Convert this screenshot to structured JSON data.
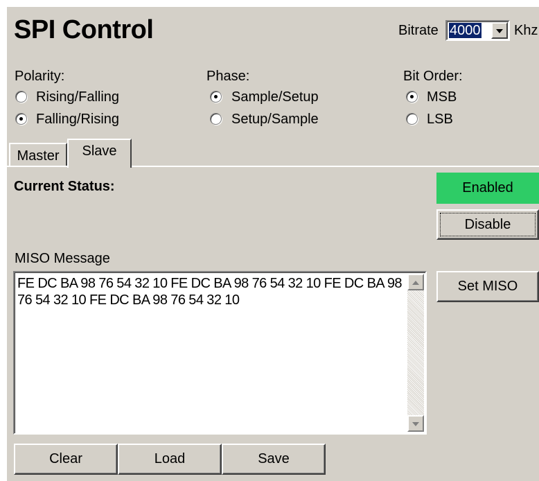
{
  "header": {
    "title": "SPI Control",
    "bitrate_label": "Bitrate",
    "bitrate_value": "4000",
    "bitrate_unit": "Khz"
  },
  "polarity": {
    "label": "Polarity:",
    "options": [
      {
        "label": "Rising/Falling",
        "selected": false
      },
      {
        "label": "Falling/Rising",
        "selected": true
      }
    ]
  },
  "phase": {
    "label": "Phase:",
    "options": [
      {
        "label": "Sample/Setup",
        "selected": true
      },
      {
        "label": "Setup/Sample",
        "selected": false
      }
    ]
  },
  "bit_order": {
    "label": "Bit Order:",
    "options": [
      {
        "label": "MSB",
        "selected": true
      },
      {
        "label": "LSB",
        "selected": false
      }
    ]
  },
  "tabs": [
    {
      "label": "Master",
      "active": false
    },
    {
      "label": "Slave",
      "active": true
    }
  ],
  "slave": {
    "status_label": "Current Status:",
    "status_value": "Enabled",
    "disable_button": "Disable",
    "miso_label": "MISO Message",
    "miso_text": "FE DC BA 98 76 54 32 10 FE DC BA 98 76 54 32 10 FE DC BA 98 76 54 32 10 FE DC BA 98 76 54 32 10",
    "set_miso_button": "Set MISO",
    "clear_button": "Clear",
    "load_button": "Load",
    "save_button": "Save"
  },
  "colors": {
    "panel": "#d4d0c8",
    "status_enabled": "#2ecc66",
    "selection": "#0a246a"
  },
  "icons": {
    "combo_arrow": "chevron-down-icon",
    "scroll_up": "scroll-up-arrow-icon",
    "scroll_down": "scroll-down-arrow-icon"
  }
}
